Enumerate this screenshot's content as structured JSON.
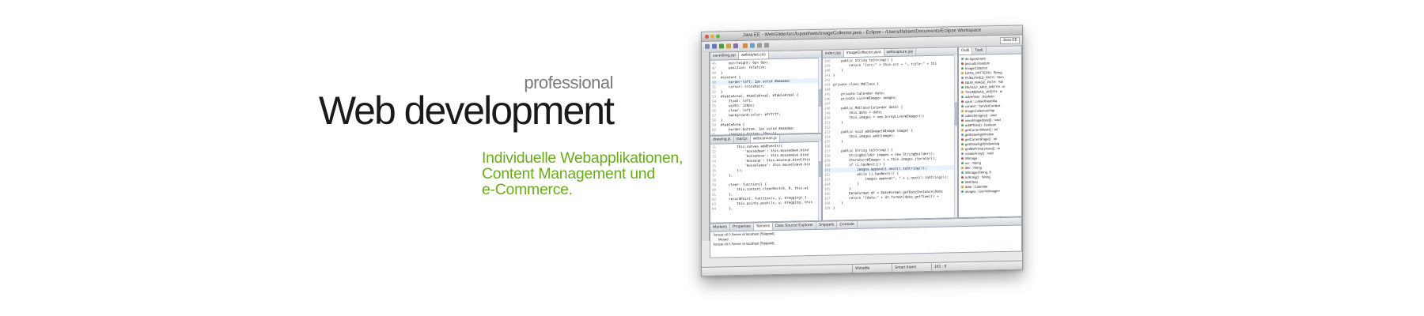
{
  "headline": {
    "small": "professional",
    "large": "Web development"
  },
  "services": [
    "Individuelle Webapplikationen,",
    "Content Management und",
    "e-Commerce."
  ],
  "colors": {
    "green_text": "#6aaa1e",
    "headline_text": "#1a1a1a",
    "small_text": "#7a7a7a"
  },
  "ide": {
    "window_title": "Java EE - WebGlider/src/lupaid/web/ImageCollector.java - Eclipse - /Users/lfabian/Documents/Eclipse Workspace",
    "perspective": "Java EE",
    "css_editor": {
      "tabs": [
        "savetiting.jsp",
        "webstyles.css"
      ],
      "lines": [
        "    min-height: 6px 8px;",
        "    position: relative;",
        "}",
        "#content {",
        "    border-left: 1px solid #aaaaaa;",
        "    cursor: crosshair;",
        "}",
        "#tableAreal, #tableAreal, #tableAreal {",
        "    float: left;",
        "    width: 120px;",
        "    clear: left;",
        "    background-color: #ffffff;",
        "}",
        "#tableArea {",
        "    border-bottom: 1px solid #aaaaaa;",
        "    /*margin-bottom: 10px;*/"
      ]
    },
    "js_editor": {
      "tabs": [
        "drawing.js",
        "mail.js",
        "webcanvas.js"
      ],
      "lines": [
        "        this.canvas.addEvents({",
        "            'mousedown': this.mousedown.bind",
        "            'mousemove': this.mousemove.bind",
        "            'mouseup': this.mouseup.bind(this",
        "            'mouseleave': this.mouseleave.bin",
        "        });",
        "    },",
        "",
        "    clear: function() {",
        "        this.context.clearRect(0, 0, this.wi",
        "    },",
        "    recordPoint: function(x, y, dragging) {",
        "        this.points.push([x, y, dragging, this",
        "    },"
      ]
    },
    "java_editor": {
      "tabs": [
        "index.jsp",
        "ImageCollector.java",
        "webcapture.jsp"
      ],
      "lines": [
        "    public String toString() {",
        "        return \"[src:\" + this.src + \", title:\" + thi",
        "    }",
        "}",
        "",
        "private class MdClass {",
        "",
        "    private Calendar date;",
        "    private List<WImage> images;",
        "",
        "    public MdClass(Calendar date) {",
        "        this.date = date;",
        "        this.images = new ArrayList<WImage>();",
        "    }",
        "",
        "    public void addImage(WImage image) {",
        "        this.images.add(image);",
        "    }",
        "",
        "    public String toString() {",
        "        StringBuilder images = new StringBuilder();",
        "        Iterator<WImage> i = this.images.iterator();",
        "        if (i.hasNext()) {",
        "            images.append(i.next().toString());",
        "            while (i.hasNext()) {",
        "                images.append(\", \" + i.next().toString());",
        "            }",
        "        }",
        "        DateFormat df = DateFormat.getDateInstance(Date",
        "        return \"[date:\" + df.format(date.getTime()) + ",
        "    }",
        "}"
      ]
    },
    "outline": {
      "tabs": [
        "Outli",
        "Task"
      ],
      "items": [
        "de.lupaid.web",
        "java.util.Random",
        "ImageCollector",
        "DATE_PATTERN : String",
        "PUBLISHED_PATH : Strin",
        "NEW_IMAGE_PATH : Stri",
        "RESULT_MAX_WIDTH : in",
        "THUMBNAIL_WIDTH : in",
        "advertiser : boolean",
        "cpus : LinkedHashMa",
        "context : ServletContext",
        "ImageCollector(Http",
        "collectImages() : void",
        "saveImage(byte[]) : void",
        "addPhoto() : boolean",
        "getCurrentWeek() : int",
        "getDrawingWindow",
        "getCurrentPage() : int",
        "getDrawingWindowAvg",
        "getMyPrimaryArea() : in",
        "createArray() : void",
        "WImage",
        "src : String",
        "title : String",
        "WImage(String, S",
        "toString() : String",
        "MdClass",
        "date : Calendar",
        "images : List<WImage>"
      ]
    },
    "bottom_panel": {
      "tabs": [
        "Markers",
        "Properties",
        "Servers",
        "Data Source Explorer",
        "Snippets",
        "Console"
      ],
      "rows": [
        "Tomcat v6.0 Server at localhost  [Stopped]",
        "Mesad",
        "Tomcat v5.5 Server at localhost  [Stopped]"
      ]
    },
    "status": {
      "mode": "Writable",
      "insert": "Smart Insert",
      "position": "163 : 9"
    }
  }
}
